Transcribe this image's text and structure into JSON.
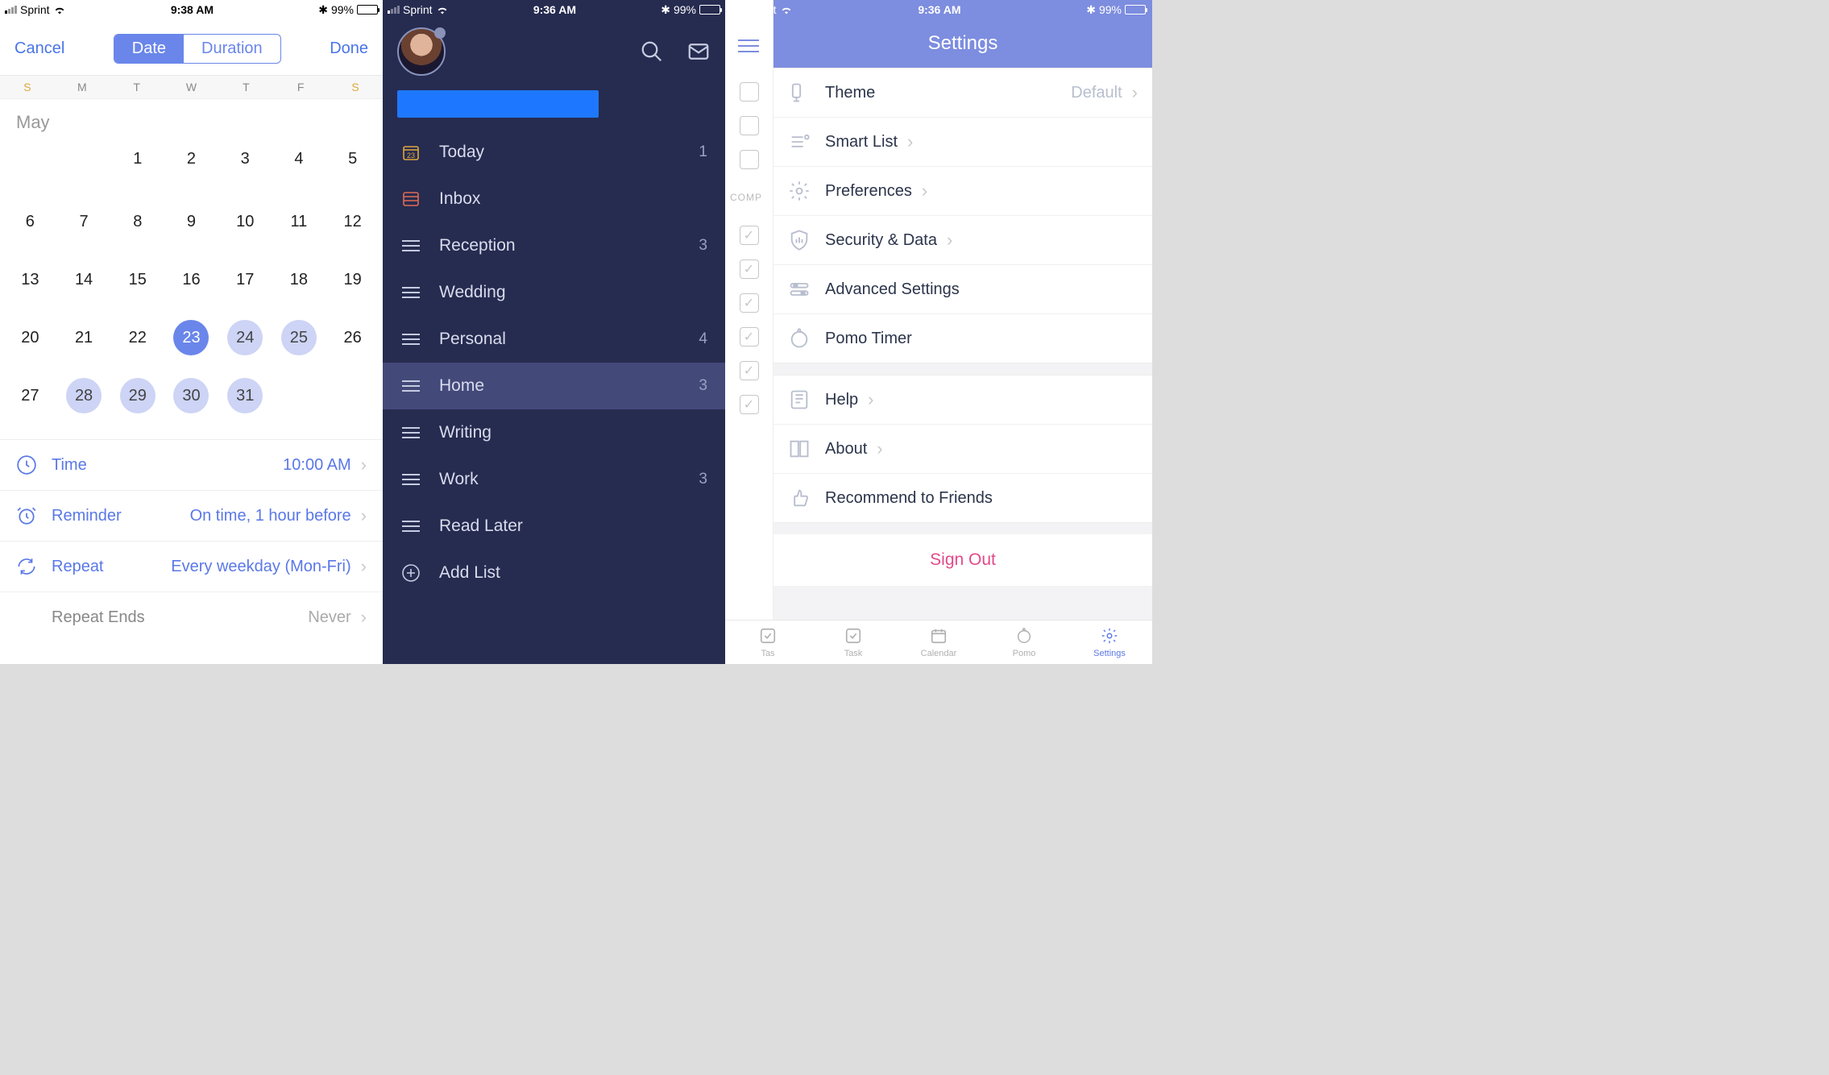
{
  "status": {
    "carrier": "Sprint",
    "time1": "9:38 AM",
    "time2": "9:36 AM",
    "time3": "9:36 AM",
    "battery": "99%",
    "bluetooth": "✱"
  },
  "pane1": {
    "cancel": "Cancel",
    "done": "Done",
    "seg_date": "Date",
    "seg_duration": "Duration",
    "weekdays": [
      "S",
      "M",
      "T",
      "W",
      "T",
      "F",
      "S"
    ],
    "month": "May",
    "days": [
      [
        "",
        "",
        "1",
        "2",
        "3",
        "4",
        "5"
      ],
      [
        "6",
        "7",
        "8",
        "9",
        "10",
        "11",
        "12"
      ],
      [
        "13",
        "14",
        "15",
        "16",
        "17",
        "18",
        "19"
      ],
      [
        "20",
        "21",
        "22",
        "23",
        "24",
        "25",
        "26"
      ],
      [
        "27",
        "28",
        "29",
        "30",
        "31",
        "",
        ""
      ]
    ],
    "selected": "23",
    "highlighted": [
      "24",
      "25",
      "28",
      "29",
      "30",
      "31"
    ],
    "rows": {
      "time_l": "Time",
      "time_v": "10:00 AM",
      "rem_l": "Reminder",
      "rem_v": "On time, 1 hour before",
      "rep_l": "Repeat",
      "rep_v": "Every weekday (Mon-Fri)",
      "end_l": "Repeat Ends",
      "end_v": "Never"
    }
  },
  "pane2": {
    "items": [
      {
        "icon": "calendar",
        "label": "Today",
        "count": "1",
        "color": "#e0a73a"
      },
      {
        "icon": "inbox",
        "label": "Inbox",
        "count": "",
        "color": "#e06a54"
      },
      {
        "icon": "list",
        "label": "Reception",
        "count": "3",
        "color": "#c6cbe0"
      },
      {
        "icon": "list",
        "label": "Wedding",
        "count": "",
        "color": "#c6cbe0"
      },
      {
        "icon": "list",
        "label": "Personal",
        "count": "4",
        "color": "#c6cbe0"
      },
      {
        "icon": "list",
        "label": "Home",
        "count": "3",
        "color": "#c6cbe0",
        "active": true
      },
      {
        "icon": "list",
        "label": "Writing",
        "count": "",
        "color": "#c6cbe0"
      },
      {
        "icon": "list",
        "label": "Work",
        "count": "3",
        "color": "#c6cbe0"
      },
      {
        "icon": "list",
        "label": "Read Later",
        "count": "",
        "color": "#c6cbe0"
      },
      {
        "icon": "add",
        "label": "Add List",
        "count": "",
        "color": "#c6cbe0"
      }
    ]
  },
  "pane3": {
    "title": "Settings",
    "section_label": "COMP",
    "groups": [
      [
        {
          "icon": "theme",
          "label": "Theme",
          "value": "Default",
          "chev": true
        },
        {
          "icon": "smart",
          "label": "Smart List",
          "value": "",
          "chev": true
        },
        {
          "icon": "gear",
          "label": "Preferences",
          "value": "",
          "chev": true
        },
        {
          "icon": "shield",
          "label": "Security & Data",
          "value": "",
          "chev": true
        },
        {
          "icon": "sliders",
          "label": "Advanced Settings",
          "value": "",
          "chev": false
        },
        {
          "icon": "pomo",
          "label": "Pomo Timer",
          "value": "",
          "chev": false
        }
      ],
      [
        {
          "icon": "help",
          "label": "Help",
          "value": "",
          "chev": true
        },
        {
          "icon": "about",
          "label": "About",
          "value": "",
          "chev": true
        },
        {
          "icon": "thumb",
          "label": "Recommend to Friends",
          "value": "",
          "chev": false
        }
      ]
    ],
    "signout": "Sign Out",
    "tabs": [
      {
        "label": "Tas",
        "icon": "check"
      },
      {
        "label": "Task",
        "icon": "check"
      },
      {
        "label": "Calendar",
        "icon": "cal"
      },
      {
        "label": "Pomo",
        "icon": "pomo"
      },
      {
        "label": "Settings",
        "icon": "gear",
        "active": true
      }
    ]
  }
}
